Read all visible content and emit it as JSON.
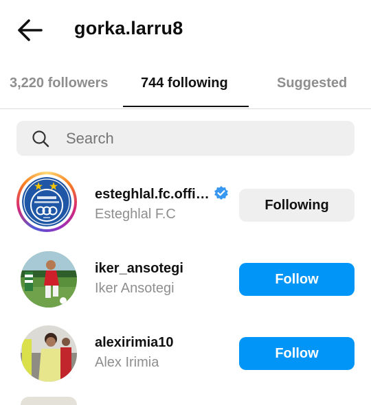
{
  "header": {
    "title": "gorka.larru8",
    "back_icon": "arrow-left-icon"
  },
  "tabs": [
    {
      "label": "3,220 followers",
      "active": false
    },
    {
      "label": "744 following",
      "active": true
    },
    {
      "label": "Suggested",
      "active": false
    }
  ],
  "search": {
    "placeholder": "Search",
    "value": "",
    "icon": "search-icon"
  },
  "rows": [
    {
      "username": "esteghlal.fc.offi…",
      "verified": true,
      "fullname": "Esteghlal F.C",
      "button": "Following",
      "button_style": "gray",
      "avatar_logo_text": "استقلال\nESTEGHLAL F.C\n1945"
    },
    {
      "username": "iker_ansotegi",
      "verified": false,
      "fullname": "Iker Ansotegi",
      "button": "Follow",
      "button_style": "blue"
    },
    {
      "username": "alexirimia10",
      "verified": false,
      "fullname": "Alex Irimia",
      "button": "Follow",
      "button_style": "blue"
    }
  ],
  "colors": {
    "accent": "#0095f6",
    "muted": "#8e8e8e",
    "verified": "#3897f0"
  }
}
